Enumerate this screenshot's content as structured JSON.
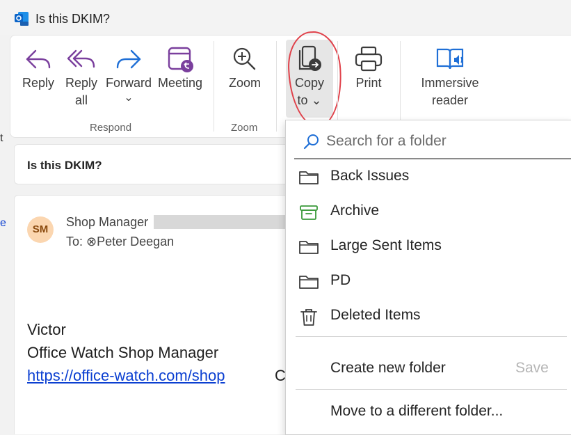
{
  "window": {
    "title": "Is this DKIM?"
  },
  "ribbon": {
    "reply": "Reply",
    "reply_all_1": "Reply",
    "reply_all_2": "all",
    "forward": "Forward",
    "forward_chevron": "⌄",
    "meeting": "Meeting",
    "respond_group": "Respond",
    "zoom": "Zoom",
    "zoom_group": "Zoom",
    "copy_1": "Copy",
    "copy_2": "to ⌄",
    "print": "Print",
    "immersive_1": "Immersive",
    "immersive_2": "reader"
  },
  "message": {
    "subject": "Is this DKIM?",
    "avatar_initials": "SM",
    "sender": "Shop Manager",
    "to": "To: ⊗Peter Deegan",
    "body_name": "Victor",
    "body_title": "Office Watch Shop Manager",
    "body_link": "https://office-watch.com/shop",
    "body_trail": "C"
  },
  "left_edge": {
    "frag1": "t",
    "frag2": "e"
  },
  "dropdown": {
    "search_placeholder": "Search for a folder",
    "folders": [
      {
        "label": "Back Issues",
        "icon": "folder-icon"
      },
      {
        "label": "Archive",
        "icon": "archive-icon"
      },
      {
        "label": "Large Sent Items",
        "icon": "folder-icon"
      },
      {
        "label": "PD",
        "icon": "folder-icon"
      },
      {
        "label": "Deleted Items",
        "icon": "trash-icon"
      }
    ],
    "create_new_folder": "Create new folder",
    "save": "Save",
    "move_to_different": "Move to a different folder..."
  },
  "colors": {
    "accent_purple": "#7a3f9d",
    "accent_blue": "#1f6fd6",
    "archive_green": "#3a9a3a",
    "highlight_red": "#e0414a",
    "link_blue": "#0b3fd1"
  }
}
